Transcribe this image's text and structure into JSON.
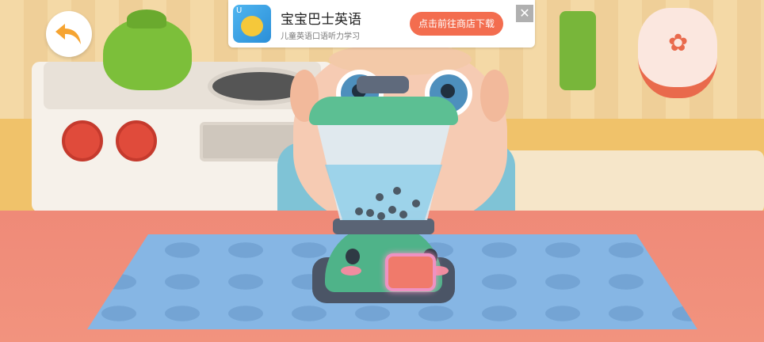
{
  "ad_banner": {
    "app_name": "宝宝巴士英语",
    "tagline": "儿童英语口语听力学习",
    "cta_label": "点击前往商店下载",
    "close_glyph": "✕",
    "icon_badge": "U"
  },
  "colors": {
    "accent_orange": "#f6a431",
    "cta": "#f36d4f",
    "blender_green": "#5cbf93"
  },
  "icons": {
    "back": "back-arrow-icon",
    "close": "close-icon"
  }
}
